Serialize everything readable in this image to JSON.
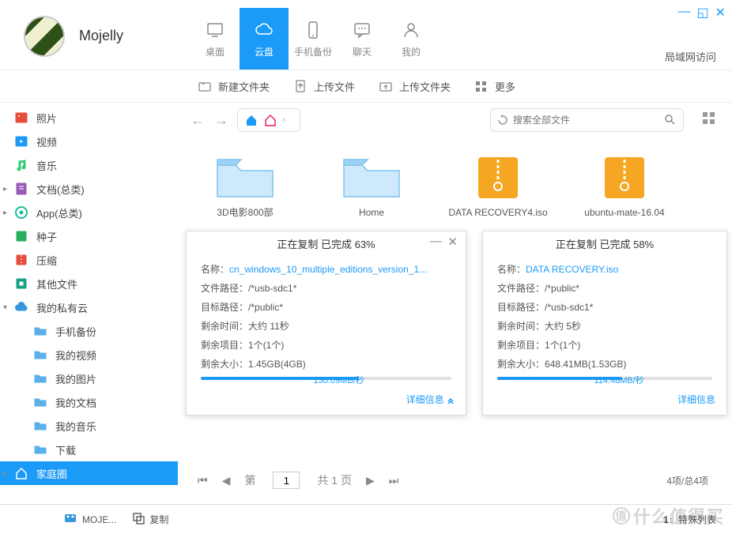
{
  "user": {
    "name": "Mojelly"
  },
  "windowControls": {
    "minimize": "—",
    "maximize": "◱",
    "close": "✕"
  },
  "lanAccess": "局域网访问",
  "topTabs": [
    {
      "label": "桌面",
      "icon": "desktop"
    },
    {
      "label": "云盘",
      "icon": "cloud",
      "active": true
    },
    {
      "label": "手机备份",
      "icon": "phone"
    },
    {
      "label": "聊天",
      "icon": "chat"
    },
    {
      "label": "我的",
      "icon": "user"
    }
  ],
  "toolbar": [
    {
      "label": "新建文件夹",
      "icon": "new-folder"
    },
    {
      "label": "上传文件",
      "icon": "upload-file"
    },
    {
      "label": "上传文件夹",
      "icon": "upload-folder"
    },
    {
      "label": "更多",
      "icon": "more"
    }
  ],
  "sidebar": [
    {
      "label": "照片",
      "icon": "photo",
      "color": "#e74c3c"
    },
    {
      "label": "视频",
      "icon": "video",
      "color": "#1b9af7"
    },
    {
      "label": "音乐",
      "icon": "music",
      "color": "#2ecc71"
    },
    {
      "label": "文档(总类)",
      "icon": "doc",
      "color": "#9b59b6",
      "expandable": true
    },
    {
      "label": "App(总类)",
      "icon": "app",
      "color": "#1abc9c",
      "expandable": true
    },
    {
      "label": "种子",
      "icon": "seed",
      "color": "#27ae60"
    },
    {
      "label": "压缩",
      "icon": "zip",
      "color": "#e74c3c"
    },
    {
      "label": "其他文件",
      "icon": "other",
      "color": "#16a085"
    },
    {
      "label": "我的私有云",
      "icon": "mycloud",
      "color": "#3498db",
      "expandable": true,
      "expanded": true
    },
    {
      "label": "手机备份",
      "icon": "folder",
      "sub": true
    },
    {
      "label": "我的视频",
      "icon": "folder",
      "sub": true
    },
    {
      "label": "我的图片",
      "icon": "folder",
      "sub": true
    },
    {
      "label": "我的文档",
      "icon": "folder",
      "sub": true
    },
    {
      "label": "我的音乐",
      "icon": "folder",
      "sub": true
    },
    {
      "label": "下载",
      "icon": "folder",
      "sub": true
    },
    {
      "label": "家庭圈",
      "icon": "home",
      "color": "#e91e63",
      "selected": true,
      "expandable": true
    }
  ],
  "search": {
    "placeholder": "搜索全部文件"
  },
  "files": [
    {
      "name": "3D电影800部",
      "type": "folder-blue"
    },
    {
      "name": "Home",
      "type": "folder-blue"
    },
    {
      "name": "DATA RECOVERY4.iso",
      "type": "zip-yellow"
    },
    {
      "name": "ubuntu-mate-16.04",
      "type": "zip-yellow"
    }
  ],
  "progress1": {
    "title": "正在复制 已完成 63%",
    "nameLabel": "名称：",
    "name": "cn_windows_10_multiple_editions_version_1...",
    "srcLabel": "文件路径：",
    "src": "/*usb-sdc1*",
    "dstLabel": "目标路径：",
    "dst": "/*public*",
    "timeLabel": "剩余时间：",
    "time": "大约 11秒",
    "itemsLabel": "剩余项目：",
    "items": "1个(1个)",
    "sizeLabel": "剩余大小：",
    "size": "1.45GB(4GB)",
    "speed": "130.09MB/秒",
    "percent": 63,
    "detail": "详细信息"
  },
  "progress2": {
    "title": "正在复制 已完成 58%",
    "nameLabel": "名称：",
    "name": "DATA RECOVERY.iso",
    "srcLabel": "文件路径：",
    "src": "/*public*",
    "dstLabel": "目标路径：",
    "dst": "/*usb-sdc1*",
    "timeLabel": "剩余时间：",
    "time": "大约 5秒",
    "itemsLabel": "剩余项目：",
    "items": "1个(1个)",
    "sizeLabel": "剩余大小：",
    "size": "648.41MB(1.53GB)",
    "speed": "114.48MB/秒",
    "percent": 58,
    "detail": "详细信息"
  },
  "pager": {
    "pre": "第",
    "page": "1",
    "post": "共 1 页",
    "count": "4项/总4项"
  },
  "taskbar": [
    {
      "label": "MOJE...",
      "icon": "app-icon"
    },
    {
      "label": "复制",
      "icon": "copy-icon"
    }
  ],
  "taskRightLabel": "特殊列表",
  "watermark": "什么值得买"
}
